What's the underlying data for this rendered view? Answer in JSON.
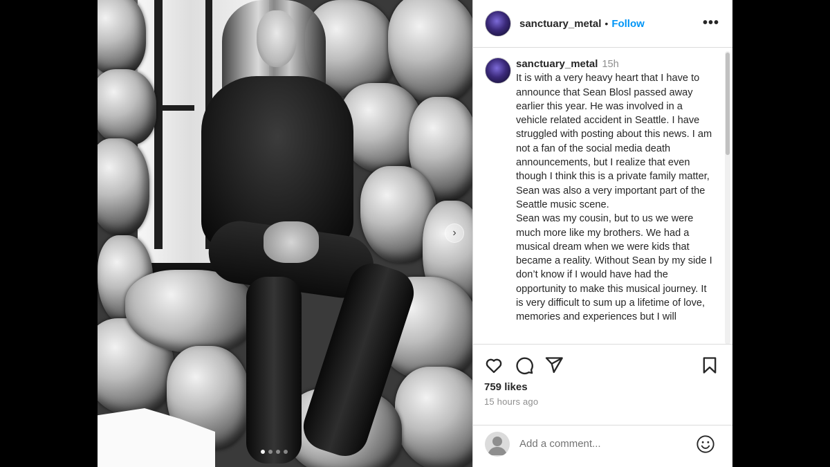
{
  "post": {
    "username": "sanctuary_metal",
    "separator": "•",
    "follow_label": "Follow",
    "more_label": "•••",
    "caption_username": "sanctuary_metal",
    "caption_time": "15h",
    "caption_para1": "It is with a very heavy heart that I have to announce that Sean Blosl passed away earlier this year. He was involved in a vehicle related accident in Seattle. I have struggled with posting about this news. I am not a fan of the social media death announcements, but I realize that even though I think this is a private family matter, Sean was also a very important part of the Seattle music scene.",
    "caption_para2": "Sean was my cousin, but to us we were much more like my brothers. We had a musical dream when we were kids that became a reality. Without Sean by my side I don’t know if I would have had the opportunity to make this musical journey. It is very difficult to sum up a lifetime of love, memories and experiences but I will",
    "likes": "759 likes",
    "posted_ago": "15 hours ago",
    "comment_placeholder": "Add a comment..."
  },
  "carousel": {
    "next_glyph": "›",
    "dot_count": 4,
    "active_dot": 1
  },
  "icons": [
    "heart-icon",
    "comment-icon",
    "share-icon",
    "bookmark-icon",
    "emoji-icon",
    "chevron-right-icon"
  ],
  "colors": {
    "accent": "#0095f6",
    "text": "#262626",
    "muted": "#8e8e8e",
    "border": "#dbdbdb"
  }
}
